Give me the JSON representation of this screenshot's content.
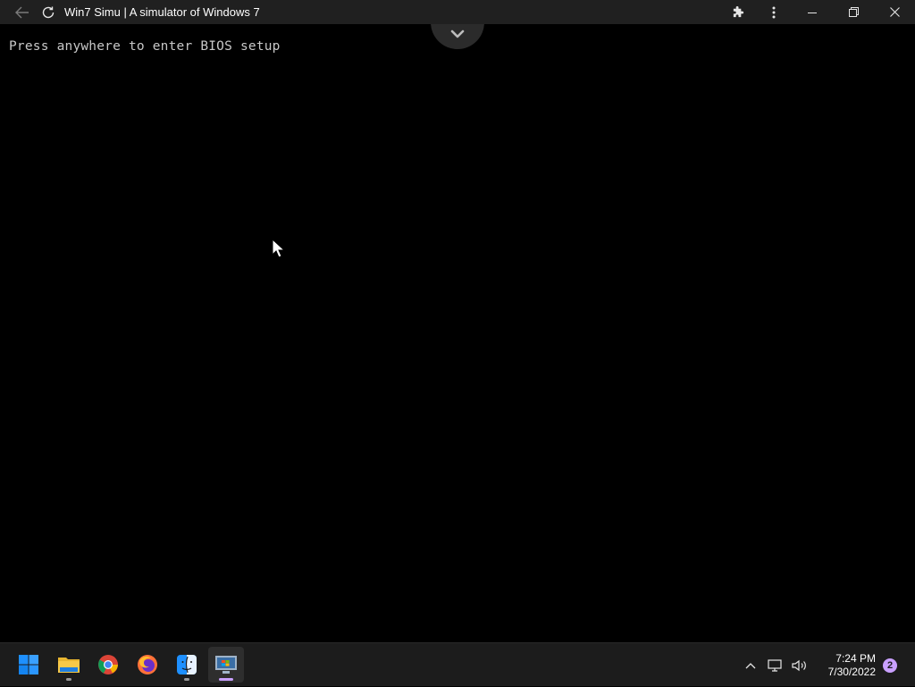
{
  "window": {
    "title": "Win7 Simu | A simulator of Windows 7",
    "icons": {
      "back": "arrow-left-icon",
      "refresh": "refresh-icon",
      "extensions": "puzzle-icon",
      "more": "more-vertical-icon",
      "minimize": "minimize-icon",
      "maximize": "restore-icon",
      "close": "close-icon"
    }
  },
  "screen": {
    "prompt": "Press anywhere to enter BIOS setup",
    "background": "#000000",
    "text_color": "#c8c8c8"
  },
  "taskbar": {
    "apps": [
      {
        "name": "start",
        "icon": "windows-start-icon",
        "running": false
      },
      {
        "name": "file-explorer",
        "icon": "folder-icon",
        "running": true
      },
      {
        "name": "chrome",
        "icon": "chrome-icon",
        "running": false
      },
      {
        "name": "firefox",
        "icon": "firefox-icon",
        "running": false
      },
      {
        "name": "finder",
        "icon": "finder-icon",
        "running": true
      },
      {
        "name": "win7-simu",
        "icon": "win7-simu-icon",
        "running": true,
        "active": true
      }
    ],
    "tray": {
      "time": "7:24 PM",
      "date": "7/30/2022",
      "notifications": "2"
    },
    "accent": "#c9a0ff"
  }
}
